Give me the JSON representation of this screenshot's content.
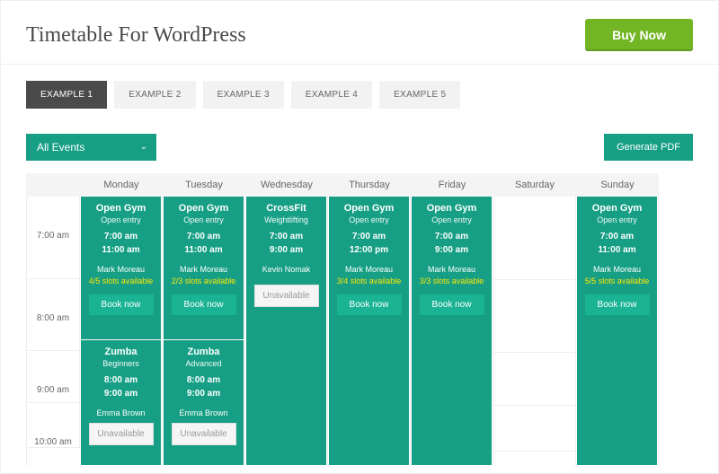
{
  "header": {
    "title": "Timetable For WordPress",
    "buy_label": "Buy Now"
  },
  "tabs": [
    "EXAMPLE 1",
    "EXAMPLE 2",
    "EXAMPLE 3",
    "EXAMPLE 4",
    "EXAMPLE 5"
  ],
  "active_tab_index": 0,
  "filter": {
    "label": "All Events"
  },
  "generate_pdf_label": "Generate PDF",
  "days": [
    "Monday",
    "Tuesday",
    "Wednesday",
    "Thursday",
    "Friday",
    "Saturday",
    "Sunday"
  ],
  "time_slots": [
    "7:00 am",
    "8:00 am",
    "9:00 am",
    "10:00 am"
  ],
  "buttons": {
    "book": "Book now",
    "unavailable": "Unavailable"
  },
  "events": {
    "mon_open_gym": {
      "title": "Open Gym",
      "sub": "Open entry",
      "t1": "7:00 am",
      "t2": "11:00 am",
      "inst": "Mark Moreau",
      "slots": "4/5 slots available",
      "action": "book"
    },
    "tue_open_gym": {
      "title": "Open Gym",
      "sub": "Open entry",
      "t1": "7:00 am",
      "t2": "11:00 am",
      "inst": "Mark Moreau",
      "slots": "2/3 slots available",
      "action": "book"
    },
    "wed_crossfit": {
      "title": "CrossFit",
      "sub": "Weightlifting",
      "t1": "7:00 am",
      "t2": "9:00 am",
      "inst": "Kevin Nomak",
      "slots": "",
      "action": "unavailable"
    },
    "thu_open_gym": {
      "title": "Open Gym",
      "sub": "Open entry",
      "t1": "7:00 am",
      "t2": "12:00 pm",
      "inst": "Mark Moreau",
      "slots": "3/4 slots available",
      "action": "book"
    },
    "fri_open_gym": {
      "title": "Open Gym",
      "sub": "Open entry",
      "t1": "7:00 am",
      "t2": "9:00 am",
      "inst": "Mark Moreau",
      "slots": "3/3 slots available",
      "action": "book"
    },
    "sun_open_gym": {
      "title": "Open Gym",
      "sub": "Open entry",
      "t1": "7:00 am",
      "t2": "11:00 am",
      "inst": "Mark Moreau",
      "slots": "5/5 slots available",
      "action": "book"
    },
    "mon_zumba": {
      "title": "Zumba",
      "sub": "Beginners",
      "t1": "8:00 am",
      "t2": "9:00 am",
      "inst": "Emma Brown",
      "slots": "",
      "action": "unavailable"
    },
    "tue_zumba": {
      "title": "Zumba",
      "sub": "Advanced",
      "t1": "8:00 am",
      "t2": "9:00 am",
      "inst": "Emma Brown",
      "slots": "",
      "action": "unavailable"
    }
  }
}
